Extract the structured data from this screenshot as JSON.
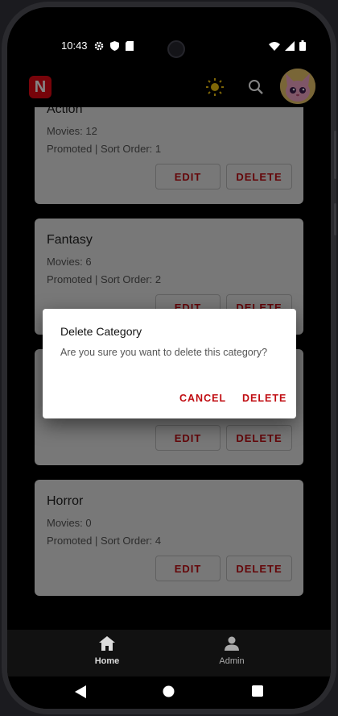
{
  "status_bar": {
    "time": "10:43"
  },
  "app_bar": {
    "logo_letter": "N"
  },
  "categories": [
    {
      "title": "Action",
      "movies": "Movies: 12",
      "meta": "Promoted | Sort Order: 1",
      "edit_label": "EDIT",
      "delete_label": "DELETE"
    },
    {
      "title": "Fantasy",
      "movies": "Movies: 6",
      "meta": "Promoted | Sort Order: 2",
      "edit_label": "EDIT",
      "delete_label": "DELETE"
    },
    {
      "title": "",
      "movies": "",
      "meta": "",
      "edit_label": "EDIT",
      "delete_label": "DELETE"
    },
    {
      "title": "Horror",
      "movies": "Movies: 0",
      "meta": "Promoted | Sort Order: 4",
      "edit_label": "EDIT",
      "delete_label": "DELETE"
    }
  ],
  "dialog": {
    "title": "Delete Category",
    "message": "Are you sure you want to delete this category?",
    "cancel_label": "CANCEL",
    "confirm_label": "DELETE"
  },
  "bottom_nav": {
    "items": [
      {
        "label": "Home",
        "icon": "home-icon",
        "active": true
      },
      {
        "label": "Admin",
        "icon": "person-icon",
        "active": false
      }
    ]
  },
  "colors": {
    "accent": "#c00d12",
    "brand": "#e50914",
    "theme_icon": "#f2c40f"
  }
}
